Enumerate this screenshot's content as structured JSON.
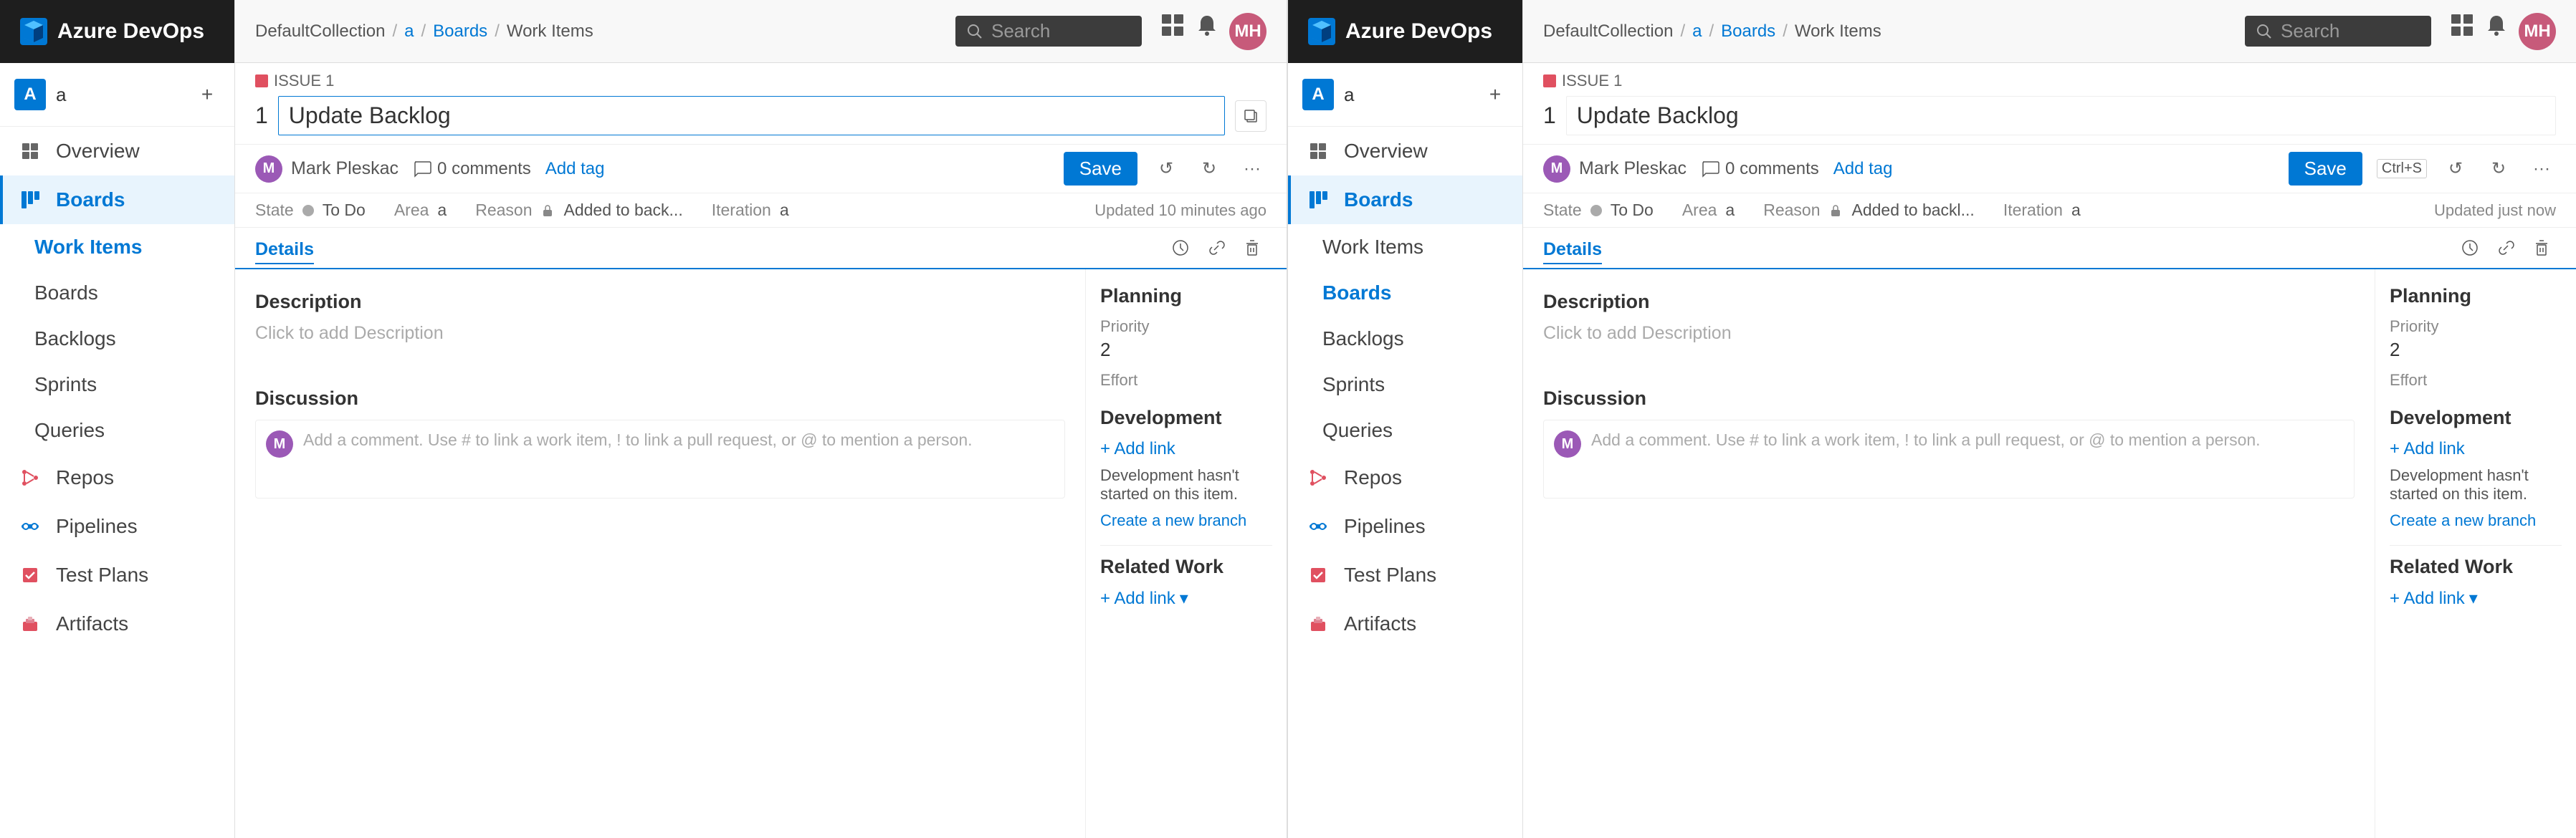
{
  "panel1": {
    "topbar": {
      "logo": "Azure DevOps",
      "breadcrumb": [
        "DefaultCollection",
        "a",
        "Boards",
        "Work Items"
      ],
      "search_placeholder": "Search",
      "avatar_initials": "MH"
    },
    "sidebar": {
      "account_icon": "A",
      "account_name": "a",
      "nav_items": [
        {
          "id": "overview",
          "label": "Overview",
          "active": false
        },
        {
          "id": "boards",
          "label": "Boards",
          "active": true
        },
        {
          "id": "work-items",
          "label": "Work Items",
          "active": true,
          "selected": true
        },
        {
          "id": "boards-sub",
          "label": "Boards",
          "active": false
        },
        {
          "id": "backlogs",
          "label": "Backlogs",
          "active": false
        },
        {
          "id": "sprints",
          "label": "Sprints",
          "active": false
        },
        {
          "id": "queries",
          "label": "Queries",
          "active": false
        },
        {
          "id": "repos",
          "label": "Repos",
          "active": false
        },
        {
          "id": "pipelines",
          "label": "Pipelines",
          "active": false
        },
        {
          "id": "test-plans",
          "label": "Test Plans",
          "active": false
        },
        {
          "id": "artifacts",
          "label": "Artifacts",
          "active": false
        }
      ]
    },
    "work_item": {
      "issue_label": "ISSUE 1",
      "issue_number": "1",
      "title": "Update Backlog",
      "assignee": "Mark Pleskac",
      "comments_count": "0 comments",
      "add_tag": "Add tag",
      "save_btn": "Save",
      "state_label": "State",
      "state_value": "To Do",
      "area_label": "Area",
      "area_value": "a",
      "reason_label": "Reason",
      "reason_value": "Added to back...",
      "iteration_label": "Iteration",
      "iteration_value": "a",
      "updated_text": "Updated 10 minutes ago",
      "details_tab": "Details",
      "description_title": "Description",
      "description_placeholder": "Click to add Description",
      "discussion_title": "Discussion",
      "discussion_placeholder": "Add a comment. Use # to link a work item, ! to link a pull request, or @ to mention a person.",
      "planning_title": "Planning",
      "priority_label": "Priority",
      "priority_value": "2",
      "effort_label": "Effort",
      "effort_value": "",
      "development_title": "Development",
      "add_link_label": "+ Add link",
      "dev_status": "Development hasn't started on this item.",
      "create_branch_link": "Create a new branch",
      "related_work_title": "Related Work",
      "related_add_link": "+ Add link"
    }
  },
  "panel2": {
    "topbar": {
      "logo": "Azure DevOps",
      "breadcrumb": [
        "DefaultCollection",
        "a",
        "Boards",
        "Work Items"
      ],
      "search_placeholder": "Search",
      "avatar_initials": "MH"
    },
    "sidebar": {
      "account_icon": "A",
      "account_name": "a",
      "nav_items": [
        {
          "id": "overview",
          "label": "Overview",
          "active": false
        },
        {
          "id": "boards",
          "label": "Boards",
          "active": true,
          "selected": true
        },
        {
          "id": "work-items",
          "label": "Work Items",
          "active": false
        },
        {
          "id": "boards-sub",
          "label": "Boards",
          "active": false,
          "selected": true
        },
        {
          "id": "backlogs",
          "label": "Backlogs",
          "active": false
        },
        {
          "id": "sprints",
          "label": "Sprints",
          "active": false
        },
        {
          "id": "queries",
          "label": "Queries",
          "active": false
        },
        {
          "id": "repos",
          "label": "Repos",
          "active": false
        },
        {
          "id": "pipelines",
          "label": "Pipelines",
          "active": false
        },
        {
          "id": "test-plans",
          "label": "Test Plans",
          "active": false
        },
        {
          "id": "artifacts",
          "label": "Artifacts",
          "active": false
        }
      ]
    },
    "work_item": {
      "issue_label": "ISSUE 1",
      "issue_number": "1",
      "title": "Update Backlog",
      "assignee": "Mark Pleskac",
      "comments_count": "0 comments",
      "add_tag": "Add tag",
      "save_btn": "Save",
      "shortcut": "Ctrl+S",
      "state_label": "State",
      "state_value": "To Do",
      "area_label": "Area",
      "area_value": "a",
      "reason_label": "Reason",
      "reason_value": "Added to backl...",
      "iteration_label": "Iteration",
      "iteration_value": "a",
      "updated_text": "Updated just now",
      "details_tab": "Details",
      "description_title": "Description",
      "description_placeholder": "Click to add Description",
      "discussion_title": "Discussion",
      "discussion_placeholder": "Add a comment. Use # to link a work item, ! to link a pull request, or @ to mention a person.",
      "planning_title": "Planning",
      "priority_label": "Priority",
      "priority_value": "2",
      "effort_label": "Effort",
      "effort_value": "",
      "development_title": "Development",
      "add_link_label": "+ Add link",
      "dev_status": "Development hasn't started on this item.",
      "create_branch_link": "Create a new branch",
      "related_work_title": "Related Work",
      "related_add_link": "+ Add link"
    }
  }
}
